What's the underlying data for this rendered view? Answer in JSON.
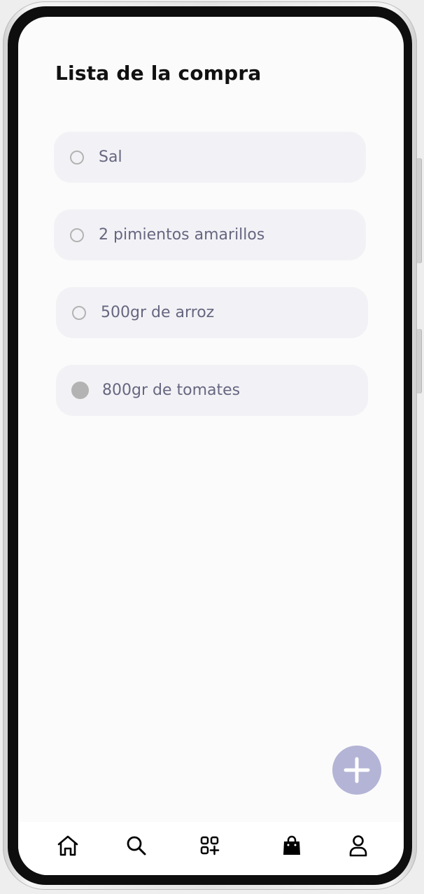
{
  "page": {
    "title": "Lista de la compra"
  },
  "shopping_list": {
    "items": [
      {
        "label": "Sal",
        "checked": false
      },
      {
        "label": "2 pimientos amarillos",
        "checked": false
      },
      {
        "label": "500gr de arroz",
        "checked": false
      },
      {
        "label": "800gr de tomates",
        "checked": true
      }
    ]
  },
  "fab": {
    "icon": "plus-icon"
  },
  "bottom_nav": {
    "items": [
      {
        "icon": "home-icon"
      },
      {
        "icon": "search-icon"
      },
      {
        "icon": "apps-add-icon"
      },
      {
        "icon": "shopping-bag-icon",
        "active": true
      },
      {
        "icon": "user-icon"
      }
    ]
  },
  "colors": {
    "item_background": "#f2f2f6",
    "item_text": "#666680",
    "radio": "#b3b3b3",
    "fab": "#b4b4d6",
    "title": "#111111"
  }
}
